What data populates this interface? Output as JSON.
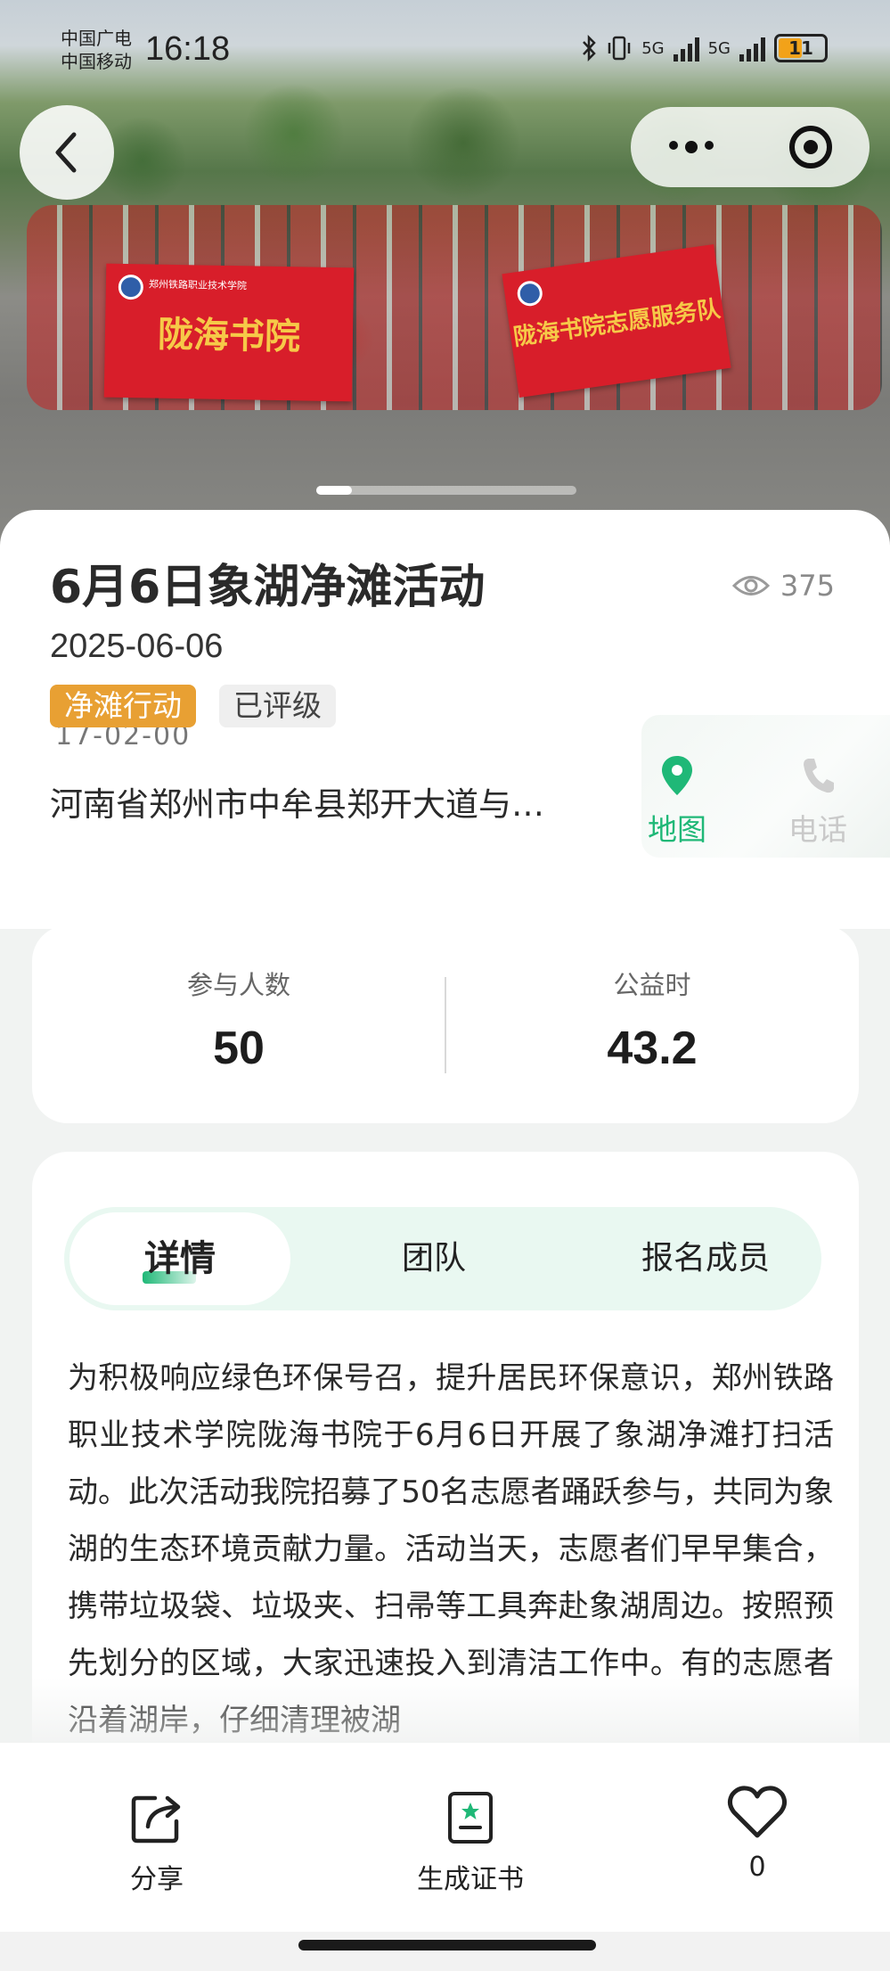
{
  "status_bar": {
    "carrier1": "中国广电",
    "carrier2": "中国移动",
    "time": "16:18",
    "net1": "5G",
    "net2": "5G",
    "battery": "11"
  },
  "hero": {
    "banner1": "陇海书院",
    "banner2": "陇海书院志愿服务队",
    "banner_small": "郑州铁路职业技术学院"
  },
  "event": {
    "title": "6月6日象湖净滩活动",
    "views": "375",
    "date": "2025-06-06",
    "tags": [
      "净滩行动",
      "已评级"
    ],
    "partial_text": "17-02-00",
    "address": "河南省郑州市中牟县郑开大道与…",
    "map_label": "地图",
    "phone_label": "电话"
  },
  "stats": {
    "participants_label": "参与人数",
    "participants_value": "50",
    "hours_label": "公益时",
    "hours_value": "43.2"
  },
  "tabs": {
    "details": "详情",
    "team": "团队",
    "members": "报名成员"
  },
  "description": "为积极响应绿色环保号召，提升居民环保意识，郑州铁路职业技术学院陇海书院于6月6日开展了象湖净滩打扫活动。此次活动我院招募了50名志愿者踊跃参与，共同为象湖的生态环境贡献力量。活动当天，志愿者们早早集合，携带垃圾袋、垃圾夹、扫帚等工具奔赴象湖周边。按照预先划分的区域，大家迅速投入到清洁工作中。有的志愿者沿着湖岸，仔细清理被湖",
  "bottom_bar": {
    "share": "分享",
    "certificate": "生成证书",
    "likes": "0"
  },
  "colors": {
    "accent_green": "#1fb877",
    "tag_orange": "#e8a033",
    "banner_red": "#d81e2a"
  }
}
